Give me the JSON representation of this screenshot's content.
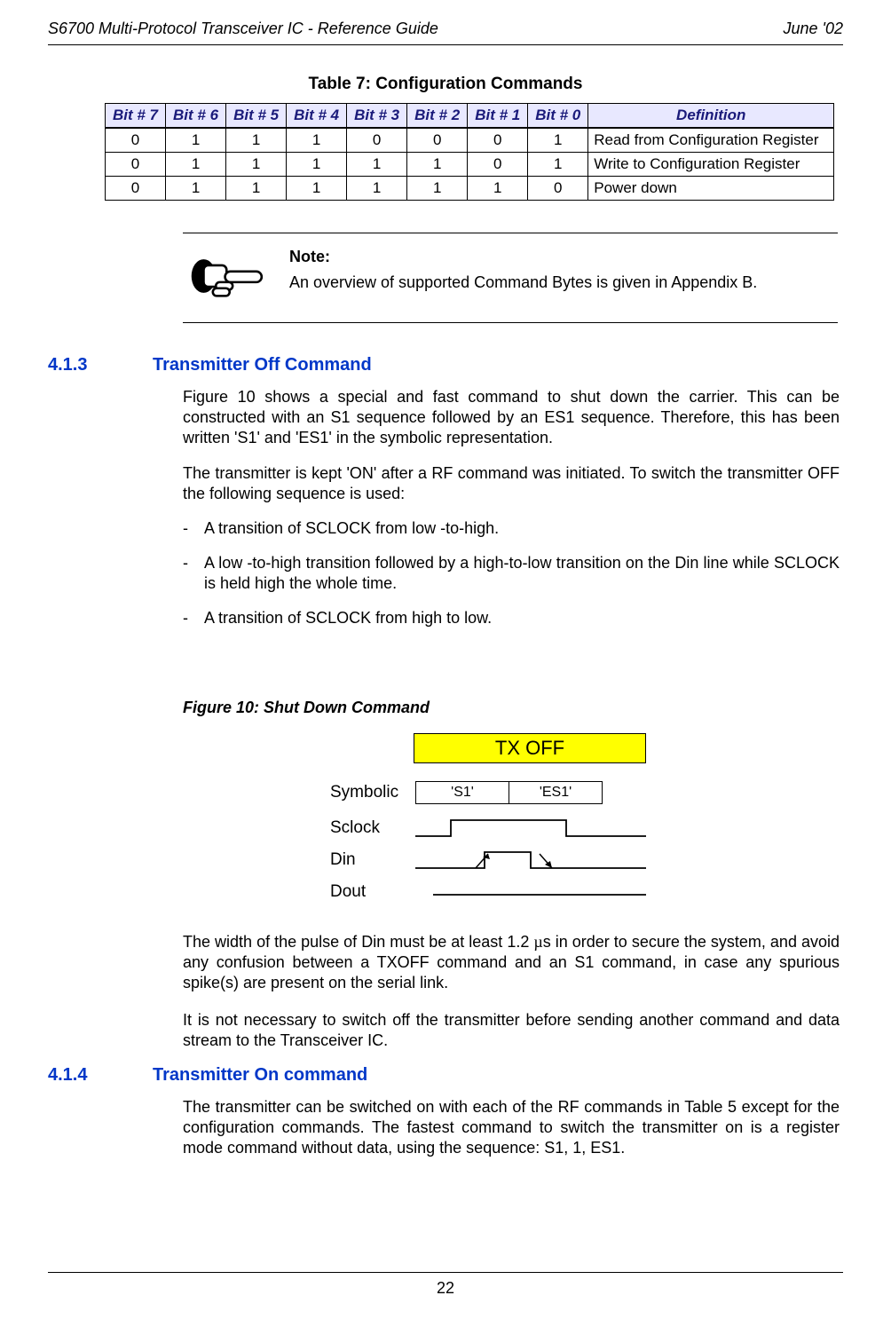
{
  "header": {
    "left": "S6700 Multi-Protocol Transceiver IC - Reference Guide",
    "right": "June '02"
  },
  "footer": {
    "page": "22"
  },
  "table": {
    "caption": "Table 7: Configuration Commands",
    "headers": [
      "Bit # 7",
      "Bit # 6",
      "Bit # 5",
      "Bit # 4",
      "Bit # 3",
      "Bit # 2",
      "Bit # 1",
      "Bit # 0",
      "Definition"
    ],
    "rows": [
      {
        "b": [
          "0",
          "1",
          "1",
          "1",
          "0",
          "0",
          "0",
          "1"
        ],
        "def": "Read from Configuration Register"
      },
      {
        "b": [
          "0",
          "1",
          "1",
          "1",
          "1",
          "1",
          "0",
          "1"
        ],
        "def": "Write to Configuration Register"
      },
      {
        "b": [
          "0",
          "1",
          "1",
          "1",
          "1",
          "1",
          "1",
          "0"
        ],
        "def": "Power down"
      }
    ]
  },
  "note": {
    "title": "Note:",
    "body": "An overview of supported Command Bytes is given in Appendix B."
  },
  "sec413": {
    "num": "4.1.3",
    "title": "Transmitter Off Command",
    "p1": "Figure 10 shows a special and fast command to shut down the carrier. This can be constructed with an S1 sequence followed by an ES1 sequence. Therefore, this has been written 'S1' and 'ES1' in the symbolic representation.",
    "p2": "The transmitter is kept 'ON' after a RF command was initiated. To switch the transmitter OFF the following sequence is used:",
    "li1": "A transition of SCLOCK from low -to-high.",
    "li2": "A low -to-high transition followed by a high-to-low transition on the Din line while SCLOCK is held high the whole time.",
    "li3": "A transition of SCLOCK from high to low.",
    "figcap": "Figure 10: Shut Down Command",
    "p3a": "The width of the pulse of Din must be at least 1.2 ",
    "p3b": "µ",
    "p3c": "s in order to secure the system, and avoid any confusion between a TXOFF command and an S1 command, in case any spurious spike(s) are present on the serial link.",
    "p4": "It is not necessary to switch off the transmitter before sending another command and data stream to the Transceiver IC."
  },
  "fig10": {
    "txoff": "TX OFF",
    "labels": {
      "symbolic": "Symbolic",
      "sclock": "Sclock",
      "din": "Din",
      "dout": "Dout"
    },
    "sym": {
      "s1": "'S1'",
      "es1": "'ES1'"
    }
  },
  "sec414": {
    "num": "4.1.4",
    "title": "Transmitter On command",
    "p1": "The transmitter can be switched on with each of the RF commands in Table 5 except for the configuration commands. The fastest command to switch the transmitter on is a register mode command without data, using the sequence: S1, 1, ES1."
  }
}
